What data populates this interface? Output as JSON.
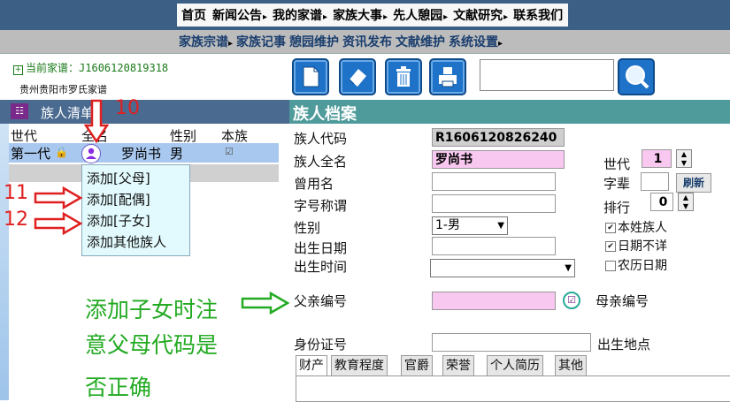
{
  "top_nav": [
    {
      "label": "首页",
      "arrow": ""
    },
    {
      "label": "新闻公告",
      "arrow": "▸"
    },
    {
      "label": "我的家谱",
      "arrow": "▸"
    },
    {
      "label": "家族大事",
      "arrow": "▸"
    },
    {
      "label": "先人憩园",
      "arrow": "▸"
    },
    {
      "label": "文献研究",
      "arrow": "▸"
    },
    {
      "label": "联系我们",
      "arrow": ""
    }
  ],
  "sub_nav": [
    {
      "label": "家族宗谱",
      "arrow": "▸"
    },
    {
      "label": "家族记事",
      "arrow": ""
    },
    {
      "label": "憩园维护",
      "arrow": ""
    },
    {
      "label": "资讯发布",
      "arrow": ""
    },
    {
      "label": "文献维护",
      "arrow": ""
    },
    {
      "label": "系统设置",
      "arrow": "▸"
    }
  ],
  "family": {
    "current_label": "当前家谱：",
    "code": "J1606120819318",
    "name": "贵州贵阳市罗氏家谱"
  },
  "member_list": {
    "title": "族人清单",
    "columns": [
      "世代",
      "全名",
      "性别",
      "本族"
    ],
    "rows": [
      {
        "generation": "第一代",
        "lock_icon": "lock-icon",
        "name": "罗尚书",
        "gender": "男",
        "same_clan": true
      }
    ]
  },
  "context_menu": [
    "添加[父母]",
    "添加[配偶]",
    "添加[子女]",
    "添加其他族人"
  ],
  "annotations": {
    "n10": "10",
    "n11": "11",
    "n12": "12",
    "note_lines": [
      "添加子女时注",
      "意父母代码是",
      "否正确"
    ]
  },
  "toolbar": {
    "icons": [
      "new-document-icon",
      "eraser-icon",
      "trash-icon",
      "printer-icon"
    ],
    "search_value": "",
    "search_icon": "magnifier-icon"
  },
  "record": {
    "title": "族人档案",
    "member_code_label": "族人代码",
    "member_code": "R1606120826240",
    "full_name_label": "族人全名",
    "full_name": "罗尚书",
    "former_name_label": "曾用名",
    "former_name": "",
    "courtesy_label": "字号称谓",
    "courtesy": "",
    "gender_label": "性别",
    "gender": "1-男",
    "birth_date_label": "出生日期",
    "birth_date": "",
    "birth_time_label": "出生时间",
    "birth_time": "",
    "father_code_label": "父亲编号",
    "father_code": "",
    "mother_code_label": "母亲编号",
    "id_card_label": "身份证号",
    "id_card": "",
    "birthplace_label": "出生地点",
    "generation_label": "世代",
    "generation": "1",
    "zibei_label": "字辈",
    "zibei": "",
    "refresh_label": "刷新",
    "rank_label": "排行",
    "rank": "0",
    "checkboxes": [
      {
        "label": "本姓族人",
        "checked": true
      },
      {
        "label": "日期不详",
        "checked": true
      },
      {
        "label": "农历日期",
        "checked": false
      }
    ]
  },
  "tabs": [
    "财产",
    "教育程度",
    "官爵",
    "荣誉",
    "个人简历",
    "其他"
  ]
}
